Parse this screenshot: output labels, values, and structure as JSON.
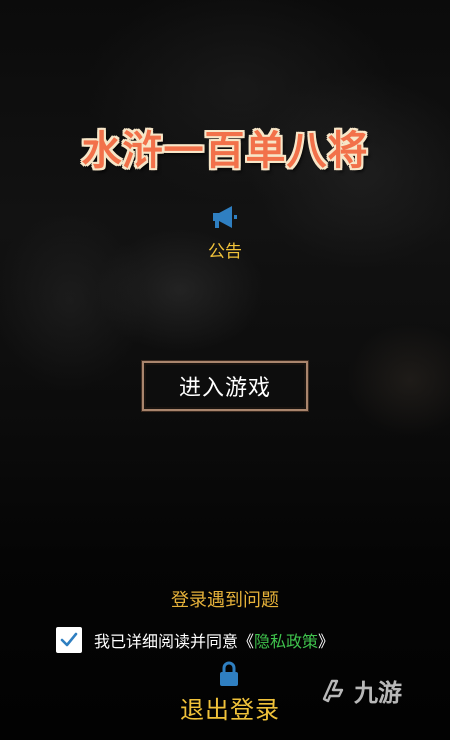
{
  "game": {
    "title": "水浒一百单八将"
  },
  "notice": {
    "icon": "megaphone-icon",
    "label": "公告"
  },
  "enter_button": {
    "label": "进入游戏"
  },
  "login_problem": {
    "label": "登录遇到问题"
  },
  "agreement": {
    "checked": true,
    "text": "我已详细阅读并同意",
    "open_bracket": "《",
    "link": "隐私政策",
    "close_bracket": "》"
  },
  "logout": {
    "icon": "lock-icon",
    "label": "退出登录"
  },
  "watermark": {
    "text": "九游"
  },
  "colors": {
    "title": "#f2714a",
    "title_outline": "#f7e6c8",
    "gold": "#f0c23a",
    "link_green": "#3fc24d",
    "button_border": "#a9856d",
    "icon_blue": "#2f7fc1"
  }
}
